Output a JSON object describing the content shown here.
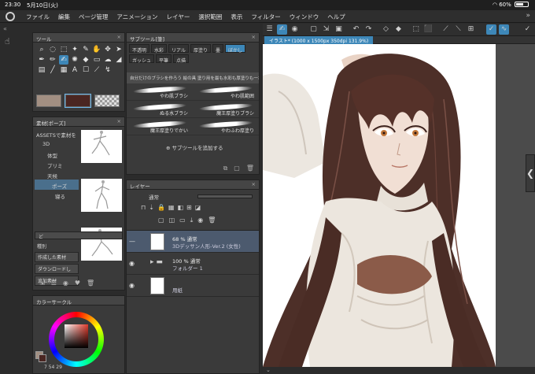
{
  "status": {
    "time": "23:30",
    "date": "5月10日(火)",
    "battery": "60%"
  },
  "menu": [
    "ファイル",
    "編集",
    "ページ管理",
    "アニメーション",
    "レイヤー",
    "選択範囲",
    "表示",
    "フィルター",
    "ウィンドウ",
    "ヘルプ"
  ],
  "tool_panel": {
    "title": "ツール"
  },
  "material_panel": {
    "title": "素材[ポーズ]",
    "tree": [
      "ASSETSで素材を",
      "3D",
      "体型",
      "プリミ",
      "天候",
      "ポーズ",
      "寝る"
    ],
    "search_placeholder": "ど",
    "tags": [
      "種別",
      "作成した素材",
      "ダウンロードし",
      "追加素材"
    ]
  },
  "color_panel": {
    "title": "カラーサークル",
    "readout": "7  54  29"
  },
  "subtool_panel": {
    "title": "サブツール[筆]",
    "tabs": [
      "不透明",
      "水彩",
      "リアル",
      "厚塗り",
      "墨",
      "ぼかし",
      "ガッシュ",
      "平筆",
      "点描",
      "厚塗り"
    ],
    "header": "自分だけのブラシを作ろう 絵の具 塗り用を最も水彩も厚塗りも一本で",
    "brushes": [
      [
        "やわ肌ブラシ",
        "やわ肌範囲"
      ],
      [
        "ぬる水ブラシ",
        "魔王厚塗りブラシ"
      ],
      [
        "魔王厚塗りでかい",
        "やわふわ厚塗り"
      ]
    ],
    "add_label": "サブツールを追加する"
  },
  "layer_panel": {
    "title": "レイヤー",
    "blend_mode": "通常",
    "layers": [
      {
        "line1": "68 %  通常",
        "line2": "3Dデッサン人形-Ver.2 (女性)",
        "selected": true
      },
      {
        "line1": "100 %  通常",
        "line2": "フォルダー 1",
        "selected": false
      },
      {
        "line1": "",
        "line2": "用紙",
        "selected": false
      }
    ]
  },
  "canvas": {
    "tab": "イラスト* (1000 x 1500px 350dpi 131.9%)"
  },
  "colors": {
    "main": "#a28f82",
    "sub": "#4a2622",
    "accent": "#3d87b8"
  }
}
